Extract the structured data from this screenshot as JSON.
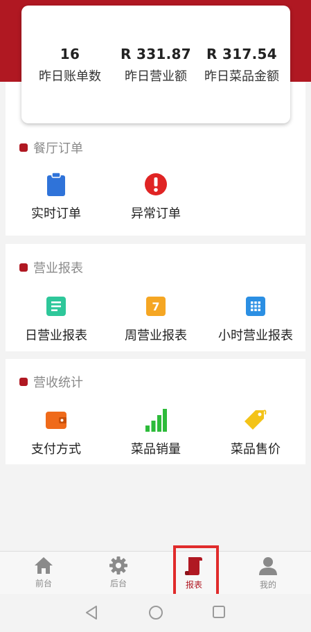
{
  "colors": {
    "brand": "#b01822",
    "highlight": "#e02b2b"
  },
  "summary": {
    "stats": [
      {
        "value": "16",
        "label": "昨日账单数"
      },
      {
        "value": "R 331.87",
        "label": "昨日营业额"
      },
      {
        "value": "R 317.54",
        "label": "昨日菜品金额"
      }
    ]
  },
  "sections": {
    "restaurant_orders": {
      "title": "餐厅订单",
      "items": [
        {
          "label": "实时订单",
          "icon": "clipboard-icon"
        },
        {
          "label": "异常订单",
          "icon": "alert-icon"
        }
      ]
    },
    "business_reports": {
      "title": "营业报表",
      "items": [
        {
          "label": "日营业报表",
          "icon": "list-icon"
        },
        {
          "label": "周营业报表",
          "icon": "calendar-7-icon",
          "badge": "7"
        },
        {
          "label": "小时营业报表",
          "icon": "grid-icon"
        }
      ]
    },
    "revenue_stats": {
      "title": "营收统计",
      "items": [
        {
          "label": "支付方式",
          "icon": "wallet-icon"
        },
        {
          "label": "菜品销量",
          "icon": "signal-bars-icon"
        },
        {
          "label": "菜品售价",
          "icon": "price-tag-icon"
        }
      ]
    }
  },
  "tabbar": {
    "tabs": [
      {
        "label": "前台",
        "icon": "home-icon"
      },
      {
        "label": "后台",
        "icon": "gear-icon"
      },
      {
        "label": "报表",
        "icon": "report-icon",
        "active": true
      },
      {
        "label": "我的",
        "icon": "user-icon"
      }
    ]
  }
}
